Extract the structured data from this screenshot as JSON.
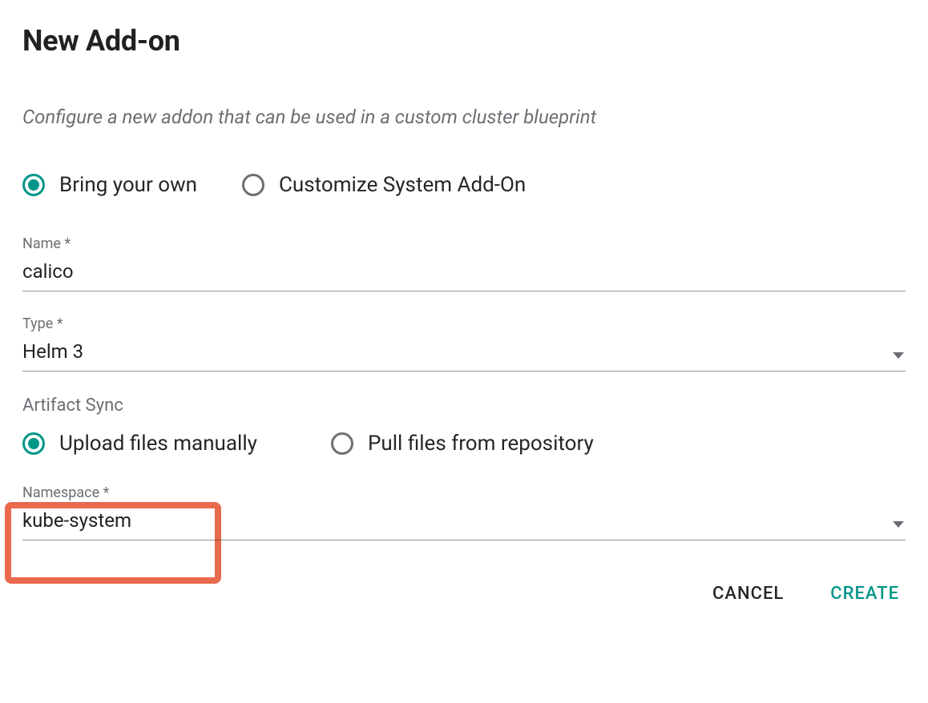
{
  "title": "New Add-on",
  "subtitle": "Configure a new addon that can be used in a custom cluster blueprint",
  "addon_source": {
    "byo": "Bring your own",
    "customize": "Customize System Add-On",
    "selected": "byo"
  },
  "fields": {
    "name": {
      "label": "Name *",
      "value": "calico"
    },
    "type": {
      "label": "Type *",
      "value": "Helm 3"
    },
    "namespace": {
      "label": "Namespace *",
      "value": "kube-system"
    }
  },
  "artifact_sync": {
    "section_label": "Artifact Sync",
    "upload": "Upload files manually",
    "pull": "Pull files from repository",
    "selected": "upload"
  },
  "actions": {
    "cancel": "CANCEL",
    "create": "CREATE"
  },
  "colors": {
    "accent": "#009688",
    "highlight": "#ea6a4e",
    "muted": "#6b6f73"
  }
}
